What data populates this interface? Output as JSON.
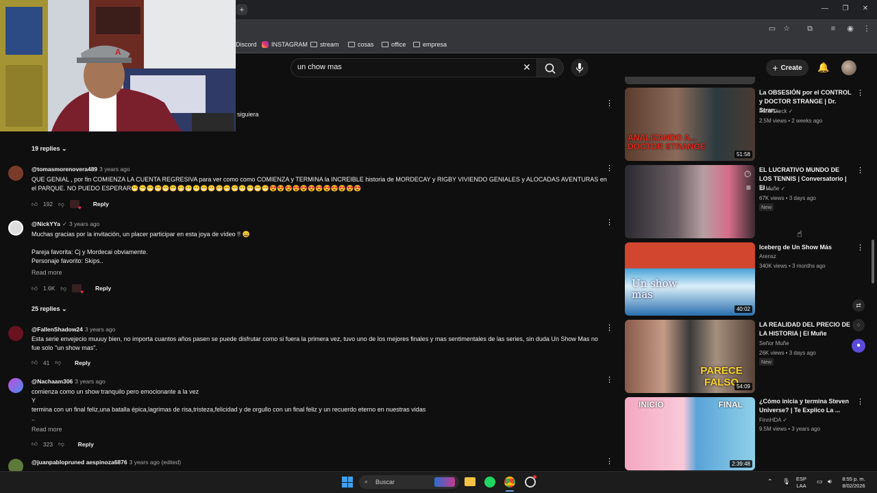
{
  "search": {
    "query": "un chow mas"
  },
  "header": {
    "create_label": "Create"
  },
  "bookmarks": [
    {
      "label": "Discord"
    },
    {
      "label": "INSTAGRAM"
    },
    {
      "label": "stream"
    },
    {
      "label": "cosas"
    },
    {
      "label": "office"
    },
    {
      "label": "empresa"
    }
  ],
  "comments": {
    "partial_top_text": "siguiera",
    "top_replies_label": "19 replies",
    "items": [
      {
        "author": "@tomasmorenovera489",
        "time": "3 years ago",
        "text": "QUE GENIAL , por fin COMIENZA LA CUENTA REGRESIVA para ver como como COMIENZA y TERMINA la INCREIBLE historia de MORDECAY y RIGBY VIVIENDO GENIALES y ALOCADAS AVENTURAS en el PARQUE. NO PUEDO ESPERAR😁😁😁😁😁😁😁😁😁😁😁😁😁😁😁😁😁😁😍😍😍😍😍😍😍😍😍😍😍😍",
        "likes": "192",
        "reply_label": "Reply"
      },
      {
        "author": "@NickYYa",
        "time": "3 years ago",
        "text": "Muchas gracias por la invitación, un placer participar en esta joya de vídeo !! 😀\n\nPareja favorita: Cj y Mordecai obviamente.\nPersonaje favorito: Skips..",
        "read_more": "Read more",
        "likes": "1.6K",
        "reply_label": "Reply",
        "replies_label": "25 replies"
      },
      {
        "author": "@FallenShadow24",
        "time": "3 years ago",
        "text": "Esta serie envejecio muuuy bien, no importa cuantos años pasen se puede disfrutar como si fuera la primera vez, tuvo uno de los mejores finales y mas sentimentales de las series, sin duda Un Show Mas no\nfue solo \"un show mas\".",
        "likes": "41",
        "reply_label": "Reply"
      },
      {
        "author": "@Nachaam306",
        "time": "3 years ago",
        "text": "comienza como un show tranquilo pero emocionante a la vez\nY\ntermina con un final feliz,una batalla épica,lagrimas de risa,tristeza,felicidad y de orgullo con un final feliz y un recuerdo eterno en nuestras vidas\n..",
        "read_more": "Read more",
        "likes": "323",
        "reply_label": "Reply"
      },
      {
        "author": "@juanpablopruned aespinoza6876",
        "time": "3 years ago (edited)"
      }
    ]
  },
  "sidebar": {
    "videos": [
      {
        "title": "La OBSESIÓN por el CONTROL y DOCTOR STRANGE | Dr. Stran...",
        "channel": "Farid Dieck",
        "meta": "2.5M views • 2 weeks ago",
        "duration": "51:58",
        "thumb_text": "ANALIZANDO A... DOCTOR STRANGE"
      },
      {
        "title": "EL LUCRATIVO MUNDO DE LOS TENNIS | Conversatorio | El ...",
        "channel": "El Muñe",
        "meta": "67K views • 3 days ago",
        "badge": "New"
      },
      {
        "title": "Iceberg de Un Show Más",
        "channel": "Arensz",
        "meta": "340K views • 3 months ago",
        "duration": "40:02",
        "thumb_text": "Un show mas"
      },
      {
        "title": "LA REALIDAD DEL PRECIO DE LA HISTORIA | El Muñe",
        "channel": "Señor Muñe",
        "meta": "26K views • 3 days ago",
        "badge": "New",
        "duration": "54:09",
        "thumb_text": "PARECE FALSO"
      },
      {
        "title": "¿Cómo inicia y termina Steven Universe? | Te Explico La ...",
        "channel": "FinnHDA",
        "meta": "9.5M views • 3 years ago",
        "duration": "2:39:48",
        "thumb_text_left": "INICIO",
        "thumb_text_right": "FINAL"
      }
    ]
  },
  "taskbar": {
    "search_placeholder": "Buscar",
    "lang": "ESP",
    "lang2": "LAA",
    "time": "8:55 p. m.",
    "date": "8/02/2026"
  }
}
